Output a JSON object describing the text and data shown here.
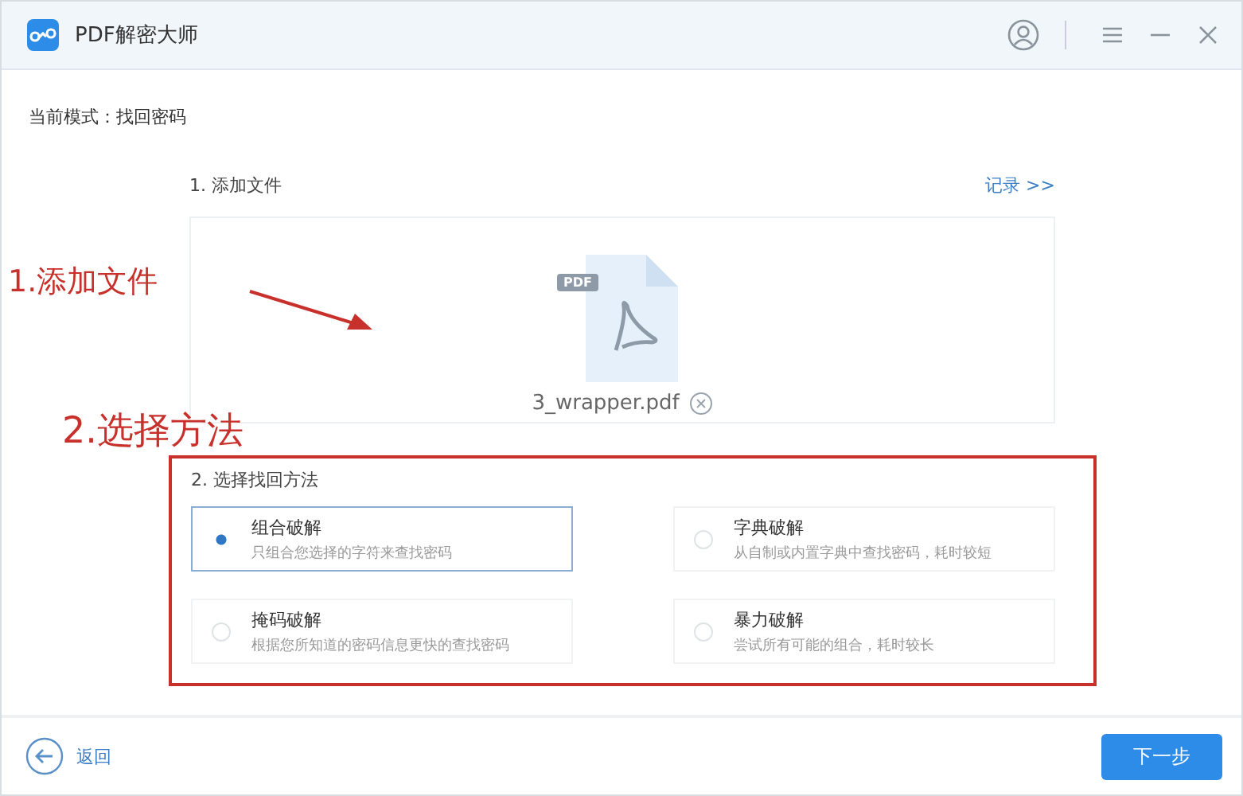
{
  "window": {
    "title": "PDF解密大师"
  },
  "mode": "当前模式：找回密码",
  "step_1": {
    "title": "1. 添加文件",
    "link": "记录 >>",
    "file": {
      "badge": "PDF",
      "name": "3_wrapper.pdf"
    }
  },
  "step_2": {
    "title": "2. 选择找回方法",
    "methods": [
      {
        "name": "组合破解",
        "description": "只组合您选择的字符来查找密码",
        "selected": true
      },
      {
        "name": "字典破解",
        "description": "从自制或内置字典中查找密码，耗时较短",
        "selected": false
      },
      {
        "name": "掩码破解",
        "description": "根据您所知道的密码信息更快的查找密码",
        "selected": false
      },
      {
        "name": "暴力破解",
        "description": "尝试所有可能的组合，耗时较长",
        "selected": false
      }
    ]
  },
  "annotations": [
    "1.添加文件",
    "2.选择方法"
  ],
  "footer": {
    "back": "返回",
    "next": "下一步"
  }
}
